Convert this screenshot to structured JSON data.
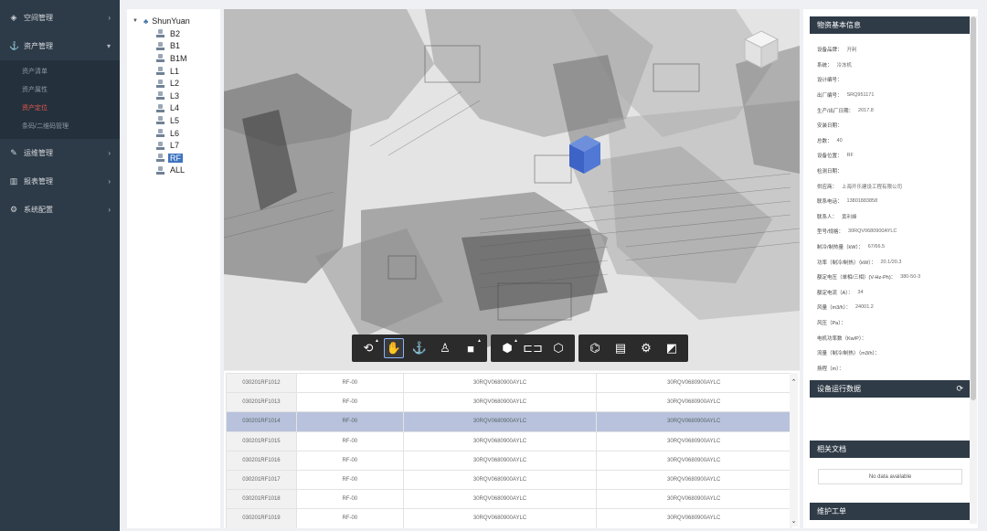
{
  "sidebar": {
    "items": [
      {
        "label": "空间管理",
        "icon": "cube-icon"
      },
      {
        "label": "资产管理",
        "icon": "anchor-icon"
      },
      {
        "label": "运维管理",
        "icon": "wrench-icon"
      },
      {
        "label": "报表管理",
        "icon": "bar-chart-icon"
      },
      {
        "label": "系统配置",
        "icon": "gear-icon"
      }
    ],
    "sub_items": [
      {
        "label": "资产清单"
      },
      {
        "label": "资产属性"
      },
      {
        "label": "资产定位"
      },
      {
        "label": "条码/二维码管理"
      }
    ]
  },
  "tree": {
    "root": "ShunYuan",
    "nodes": [
      "B2",
      "B1",
      "B1M",
      "L1",
      "L2",
      "L3",
      "L4",
      "L5",
      "L6",
      "L7",
      "RF",
      "ALL"
    ],
    "selected": "RF"
  },
  "viewer": {
    "toolbar_groups": [
      [
        "orbit-icon",
        "pan-hand-icon",
        "anchor-icon",
        "person-icon",
        "camera-icon"
      ],
      [
        "explode-cube-icon",
        "section-icon",
        "cube-icon"
      ],
      [
        "model-tree-icon",
        "properties-icon",
        "settings-gear-icon",
        "fullscreen-icon"
      ]
    ]
  },
  "table": {
    "rows": [
      [
        "030201RF1012",
        "RF-00",
        "30RQV0680900AYLC",
        "30RQV0680900AYLC"
      ],
      [
        "030201RF1013",
        "RF-00",
        "30RQV0680900AYLC",
        "30RQV0680900AYLC"
      ],
      [
        "030201RF1014",
        "RF-00",
        "30RQV0680900AYLC",
        "30RQV0680900AYLC"
      ],
      [
        "030201RF1015",
        "RF-00",
        "30RQV0680900AYLC",
        "30RQV0680900AYLC"
      ],
      [
        "030201RF1016",
        "RF-00",
        "30RQV0680900AYLC",
        "30RQV0680900AYLC"
      ],
      [
        "030201RF1017",
        "RF-00",
        "30RQV0680900AYLC",
        "30RQV0680900AYLC"
      ],
      [
        "030201RF1018",
        "RF-00",
        "30RQV0680900AYLC",
        "30RQV0680900AYLC"
      ],
      [
        "030201RF1019",
        "RF-00",
        "30RQV0680900AYLC",
        "30RQV0680900AYLC"
      ]
    ],
    "selected_index": 2
  },
  "right_panel": {
    "basic_info_title": "物资基本信息",
    "fields": [
      {
        "label": "设备品牌：",
        "value": "开利"
      },
      {
        "label": "系统：",
        "value": "冷冻机"
      },
      {
        "label": "设计编号：",
        "value": ""
      },
      {
        "label": "出厂编号：",
        "value": "SRQ951171"
      },
      {
        "label": "生产/出厂日期：",
        "value": "2017.8"
      },
      {
        "label": "安装日期：",
        "value": ""
      },
      {
        "label": "总数：",
        "value": "40"
      },
      {
        "label": "设备位置：",
        "value": "RF"
      },
      {
        "label": "检测日期：",
        "value": ""
      },
      {
        "label": "供应商：",
        "value": "上海开乐建设工程有限公司"
      },
      {
        "label": "联系电话：",
        "value": "13801883858"
      },
      {
        "label": "联系人：",
        "value": "黄利峰"
      },
      {
        "label": "型号/规格：",
        "value": "30RQV0680900AYLC"
      },
      {
        "label": "制冷/制热量（kW）：",
        "value": "67/66.5"
      },
      {
        "label": "功率（制冷/制热）（kW）：",
        "value": "20.1/20.3"
      },
      {
        "label": "额定电压（单相/三相）(V-Hz-Ph)：",
        "value": "380-50-3"
      },
      {
        "label": "额定电流（A）：",
        "value": "34"
      },
      {
        "label": "风量（m3/h）：",
        "value": "24001.2"
      },
      {
        "label": "风压（Pa）：",
        "value": ""
      },
      {
        "label": "电机功率数（Kw/P）：",
        "value": ""
      },
      {
        "label": "流量（制冷/制热）（m3/h）：",
        "value": ""
      },
      {
        "label": "扬程（m）：",
        "value": ""
      }
    ],
    "runtime_title": "设备运行数据",
    "docs_title": "相关文档",
    "no_data": "No data available",
    "maintenance_title": "维护工单"
  }
}
